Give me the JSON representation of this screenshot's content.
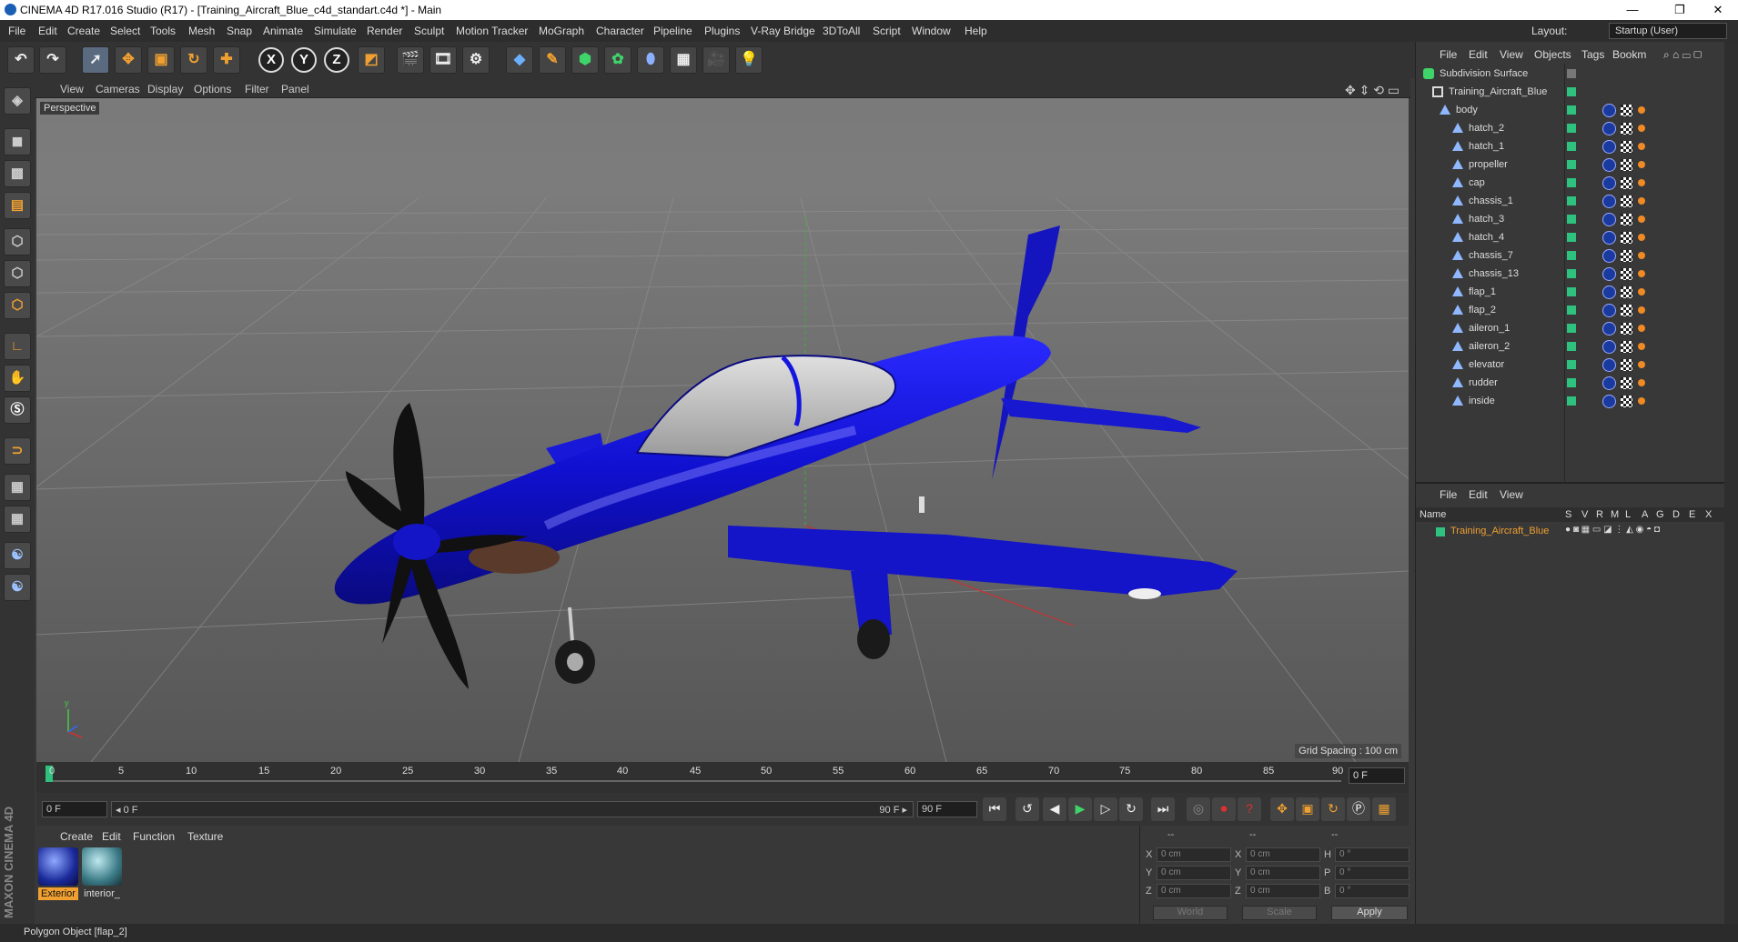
{
  "titlebar": {
    "title": "CINEMA 4D R17.016 Studio (R17) - [Training_Aircraft_Blue_c4d_standart.c4d *] - Main",
    "minimize": "—",
    "restore": "❐",
    "close": "✕"
  },
  "menubar": {
    "items": [
      "File",
      "Edit",
      "Create",
      "Select",
      "Tools",
      "Mesh",
      "Snap",
      "Animate",
      "Simulate",
      "Render",
      "Sculpt",
      "Motion Tracker",
      "MoGraph",
      "Character",
      "Pipeline",
      "Plugins",
      "V-Ray Bridge",
      "3DToAll",
      "Script",
      "Window",
      "Help"
    ],
    "layout_label": "Layout:",
    "layout_value": "Startup (User)"
  },
  "toolbar": {
    "axis_x": "X",
    "axis_y": "Y",
    "axis_z": "Z"
  },
  "viewport": {
    "menu": [
      "View",
      "Cameras",
      "Display",
      "Options",
      "Filter",
      "Panel"
    ],
    "camera_label": "Perspective",
    "grid_spacing": "Grid Spacing : 100 cm"
  },
  "timeline": {
    "ticks": [
      "0",
      "5",
      "10",
      "15",
      "20",
      "25",
      "30",
      "35",
      "40",
      "45",
      "50",
      "55",
      "60",
      "65",
      "70",
      "75",
      "80",
      "85",
      "90"
    ],
    "current_frame": "0 F"
  },
  "transport": {
    "start_field": "0 F",
    "range_start": "◂ 0 F",
    "range_end": "90 F ▸",
    "end_field": "90 F"
  },
  "material_manager": {
    "menu": [
      "Create",
      "Edit",
      "Function",
      "Texture"
    ],
    "materials": [
      {
        "label": "Exterior",
        "selected": true
      },
      {
        "label": "interior_",
        "selected": false
      }
    ]
  },
  "coordinates": {
    "headers": [
      "--",
      "--",
      "--"
    ],
    "rows": [
      {
        "a": "X",
        "pos": "0 cm",
        "b": "X",
        "size": "0 cm",
        "c": "H",
        "rot": "0 °"
      },
      {
        "a": "Y",
        "pos": "0 cm",
        "b": "Y",
        "size": "0 cm",
        "c": "P",
        "rot": "0 °"
      },
      {
        "a": "Z",
        "pos": "0 cm",
        "b": "Z",
        "size": "0 cm",
        "c": "B",
        "rot": "0 °"
      }
    ],
    "world": "World",
    "scale": "Scale",
    "apply": "Apply"
  },
  "object_manager": {
    "menu": [
      "File",
      "Edit",
      "View",
      "Objects",
      "Tags",
      "Bookm"
    ],
    "objects": [
      {
        "name": "Subdivision Surface",
        "depth": 0,
        "type": "subdivision"
      },
      {
        "name": "Training_Aircraft_Blue",
        "depth": 1,
        "type": "null"
      },
      {
        "name": "body",
        "depth": 2,
        "type": "polygon"
      },
      {
        "name": "hatch_2",
        "depth": 3,
        "type": "polygon"
      },
      {
        "name": "hatch_1",
        "depth": 3,
        "type": "polygon"
      },
      {
        "name": "propeller",
        "depth": 3,
        "type": "polygon"
      },
      {
        "name": "cap",
        "depth": 3,
        "type": "polygon"
      },
      {
        "name": "chassis_1",
        "depth": 3,
        "type": "polygon"
      },
      {
        "name": "hatch_3",
        "depth": 3,
        "type": "polygon"
      },
      {
        "name": "hatch_4",
        "depth": 3,
        "type": "polygon"
      },
      {
        "name": "chassis_7",
        "depth": 3,
        "type": "polygon"
      },
      {
        "name": "chassis_13",
        "depth": 3,
        "type": "polygon"
      },
      {
        "name": "flap_1",
        "depth": 3,
        "type": "polygon"
      },
      {
        "name": "flap_2",
        "depth": 3,
        "type": "polygon"
      },
      {
        "name": "aileron_1",
        "depth": 3,
        "type": "polygon"
      },
      {
        "name": "aileron_2",
        "depth": 3,
        "type": "polygon"
      },
      {
        "name": "elevator",
        "depth": 3,
        "type": "polygon"
      },
      {
        "name": "rudder",
        "depth": 3,
        "type": "polygon"
      },
      {
        "name": "inside",
        "depth": 3,
        "type": "polygon"
      }
    ]
  },
  "attribute_manager": {
    "menu": [
      "File",
      "Edit",
      "View"
    ],
    "columns": [
      "Name",
      "S",
      "V",
      "R",
      "M",
      "L",
      "A",
      "G",
      "D",
      "E",
      "X"
    ],
    "row_name": "Training_Aircraft_Blue"
  },
  "status": "Polygon Object [flap_2]",
  "brand": "MAXON CINEMA 4D",
  "colors": {
    "accent_orange": "#f0a030",
    "object_green": "#2ec27e",
    "aircraft_blue": "#1010e0",
    "selected_object": "#f0a030"
  }
}
